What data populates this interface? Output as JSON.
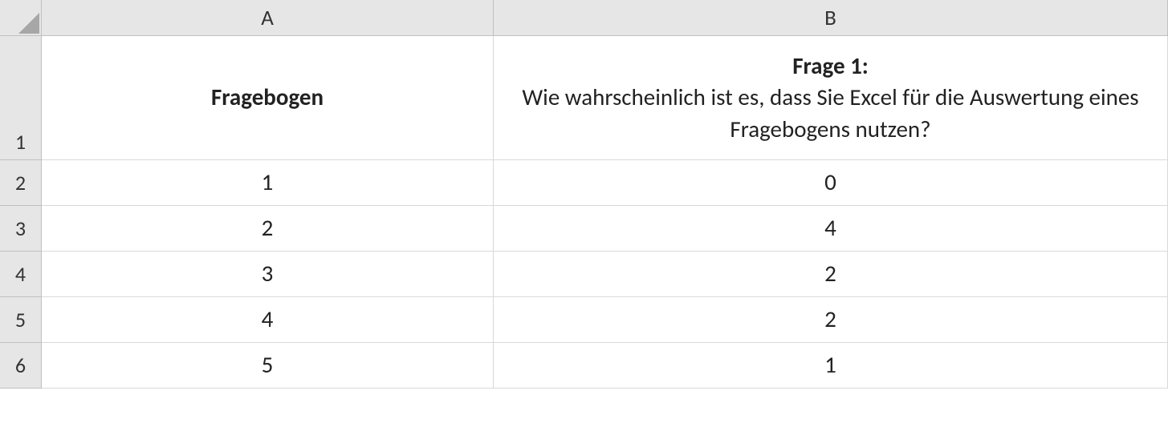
{
  "columns": [
    "A",
    "B"
  ],
  "rowNumbers": [
    "1",
    "2",
    "3",
    "4",
    "5",
    "6"
  ],
  "cells": {
    "A1": "Fragebogen",
    "B1_title": "Frage 1:",
    "B1_text": "Wie wahrscheinlich ist es, dass Sie Excel für die Auswertung eines Fragebogens nutzen?",
    "A2": "1",
    "B2": "0",
    "A3": "2",
    "B3": "4",
    "A4": "3",
    "B4": "2",
    "A5": "4",
    "B5": "2",
    "A6": "5",
    "B6": "1"
  }
}
